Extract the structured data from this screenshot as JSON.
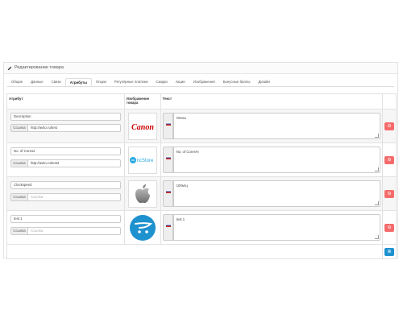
{
  "panel": {
    "title": "Редактирование товара"
  },
  "tabs": [
    {
      "label": "Общие"
    },
    {
      "label": "Данные"
    },
    {
      "label": "Связи"
    },
    {
      "label": "Атрибуты",
      "active": true
    },
    {
      "label": "Опции"
    },
    {
      "label": "Регулярные платежи"
    },
    {
      "label": "Скидки"
    },
    {
      "label": "Акции"
    },
    {
      "label": "Изображения"
    },
    {
      "label": "Бонусные баллы"
    },
    {
      "label": "Дизайн"
    }
  ],
  "table": {
    "headers": {
      "attribute": "Атрибут",
      "image_line1": "Изображение",
      "image_line2": "товара",
      "text": "Текст"
    },
    "link_label": "Ссылка",
    "link_placeholder": "Ссылка",
    "rows": [
      {
        "attribute": "Description",
        "link": "http://avito.ru/test",
        "image": "canon-logo",
        "text": "Опись"
      },
      {
        "attribute": "No. of Cores2",
        "link": "http://avito.ru/test2",
        "image": "opencart-store-logo",
        "text": "No. of Cores%"
      },
      {
        "attribute": "Clockspeed",
        "link": "",
        "image": "apple-logo",
        "text": "100мгц"
      },
      {
        "attribute": "test 1",
        "link": "",
        "image": "opencart-cart-logo",
        "text": "test 1"
      }
    ]
  },
  "colors": {
    "remove": "#f56b6b",
    "add": "#1e91cf",
    "canon": "#cc0000"
  }
}
